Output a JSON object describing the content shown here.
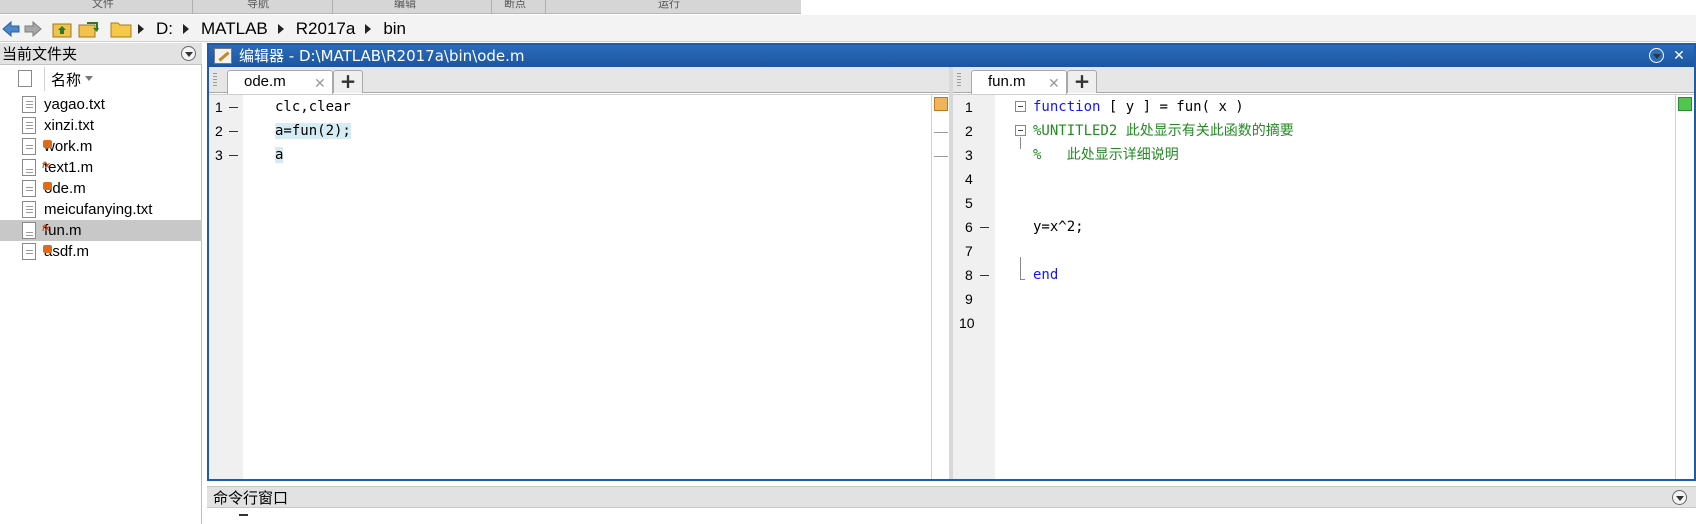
{
  "ribbon": {
    "sections": [
      "文件",
      "导航",
      "编辑",
      "断点",
      "运行"
    ]
  },
  "address_bar": {
    "path": [
      "D:",
      "MATLAB",
      "R2017a",
      "bin"
    ],
    "icons": [
      "back-arrow-icon",
      "forward-arrow-icon",
      "up-folder-icon",
      "browse-folder-icon",
      "folder-icon"
    ]
  },
  "file_browser": {
    "title": "当前文件夹",
    "column_name": "名称",
    "files": [
      {
        "name": "yagao.txt",
        "type": "txt",
        "selected": false
      },
      {
        "name": "xinzi.txt",
        "type": "txt",
        "selected": false
      },
      {
        "name": "work.m",
        "type": "script",
        "selected": false
      },
      {
        "name": "text1.m",
        "type": "function",
        "selected": false
      },
      {
        "name": "ode.m",
        "type": "script",
        "selected": false
      },
      {
        "name": "meicufanying.txt",
        "type": "txt",
        "selected": false
      },
      {
        "name": "fun.m",
        "type": "function",
        "selected": true
      },
      {
        "name": "asdf.m",
        "type": "script",
        "selected": false
      }
    ]
  },
  "editor": {
    "title": "编辑器 - D:\\MATLAB\\R2017a\\bin\\ode.m",
    "left_pane": {
      "tab": "ode.m",
      "lines": [
        {
          "num": "1",
          "code": "clc,clear"
        },
        {
          "num": "2",
          "code": "a=fun(2);"
        },
        {
          "num": "3",
          "code": "a"
        }
      ]
    },
    "right_pane": {
      "tab": "fun.m",
      "line_numbers": [
        "1",
        "2",
        "3",
        "4",
        "5",
        "6",
        "7",
        "8",
        "9",
        "10"
      ],
      "line1_keyword": "function",
      "line1_rest": " [ y ] = fun( x )",
      "line2_comment": "%UNTITLED2 此处显示有关此函数的摘要",
      "line3_comment": "%   此处显示详细说明",
      "line6_code": "y=x^2;",
      "line8_keyword": "end"
    }
  },
  "command_window": {
    "title": "命令行窗口"
  },
  "colors": {
    "title_bar": "#1e5ba8",
    "keyword": "#1515ff",
    "comment": "#228b22",
    "selected_row": "#c8c8c8"
  }
}
